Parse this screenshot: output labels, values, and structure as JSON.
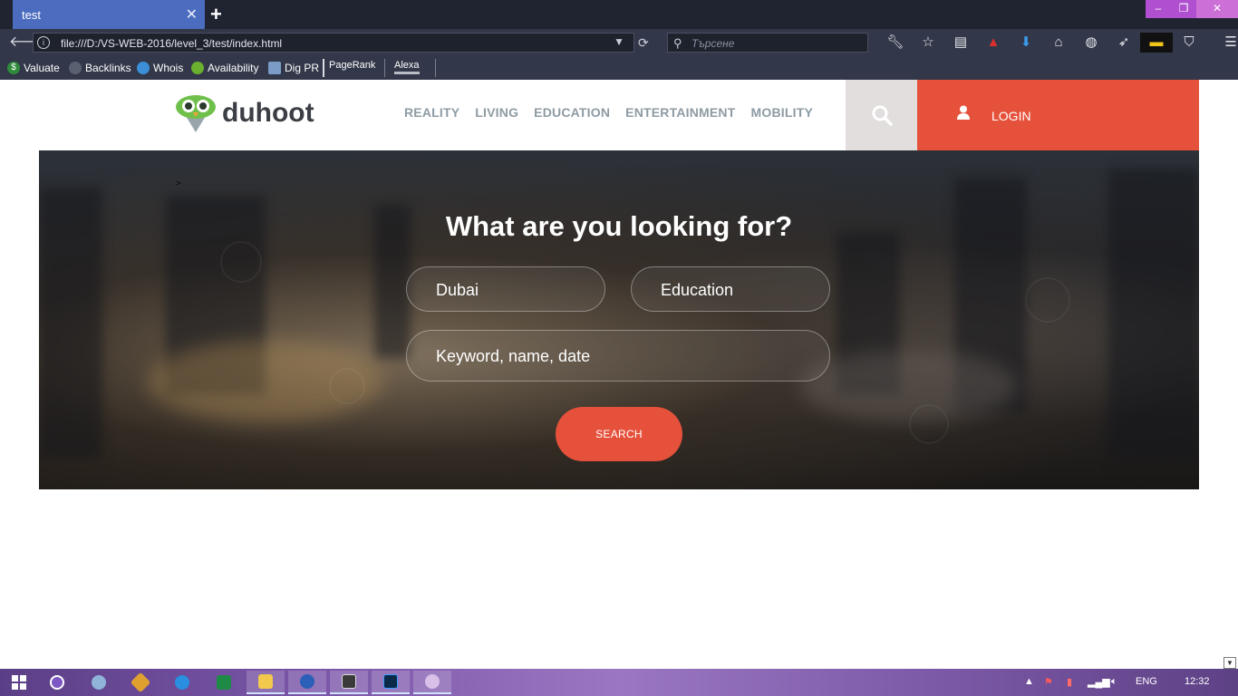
{
  "browser": {
    "tab_title": "test",
    "tab_close": "✕",
    "new_tab": "+",
    "window_controls": {
      "minimize": "‒",
      "maximize": "❐",
      "close": "✕"
    },
    "url": "file:///D:/VS-WEB-2016/level_3/test/index.html",
    "search_placeholder": "Търсене",
    "bookmarks": [
      "Valuate",
      "Backlinks",
      "Whois",
      "Availability",
      "Dig PR",
      "PageRank",
      "Alexa"
    ]
  },
  "site": {
    "logo_text": "duhoot",
    "nav": [
      "REALITY",
      "LIVING",
      "EDUCATION",
      "ENTERTAINMENT",
      "MOBILITY"
    ],
    "login_label": "LOGIN"
  },
  "hero": {
    "caret": ">",
    "title": "What are you looking for?",
    "city_value": "Dubai",
    "category_value": "Education",
    "keyword_placeholder": "Keyword, name, date",
    "search_button": "SEARCH"
  },
  "taskbar": {
    "language": "ENG",
    "time": "12:32"
  },
  "colors": {
    "accent": "#e5513b",
    "nav_text": "#8e9ba3",
    "logo_green": "#6fc04b"
  }
}
